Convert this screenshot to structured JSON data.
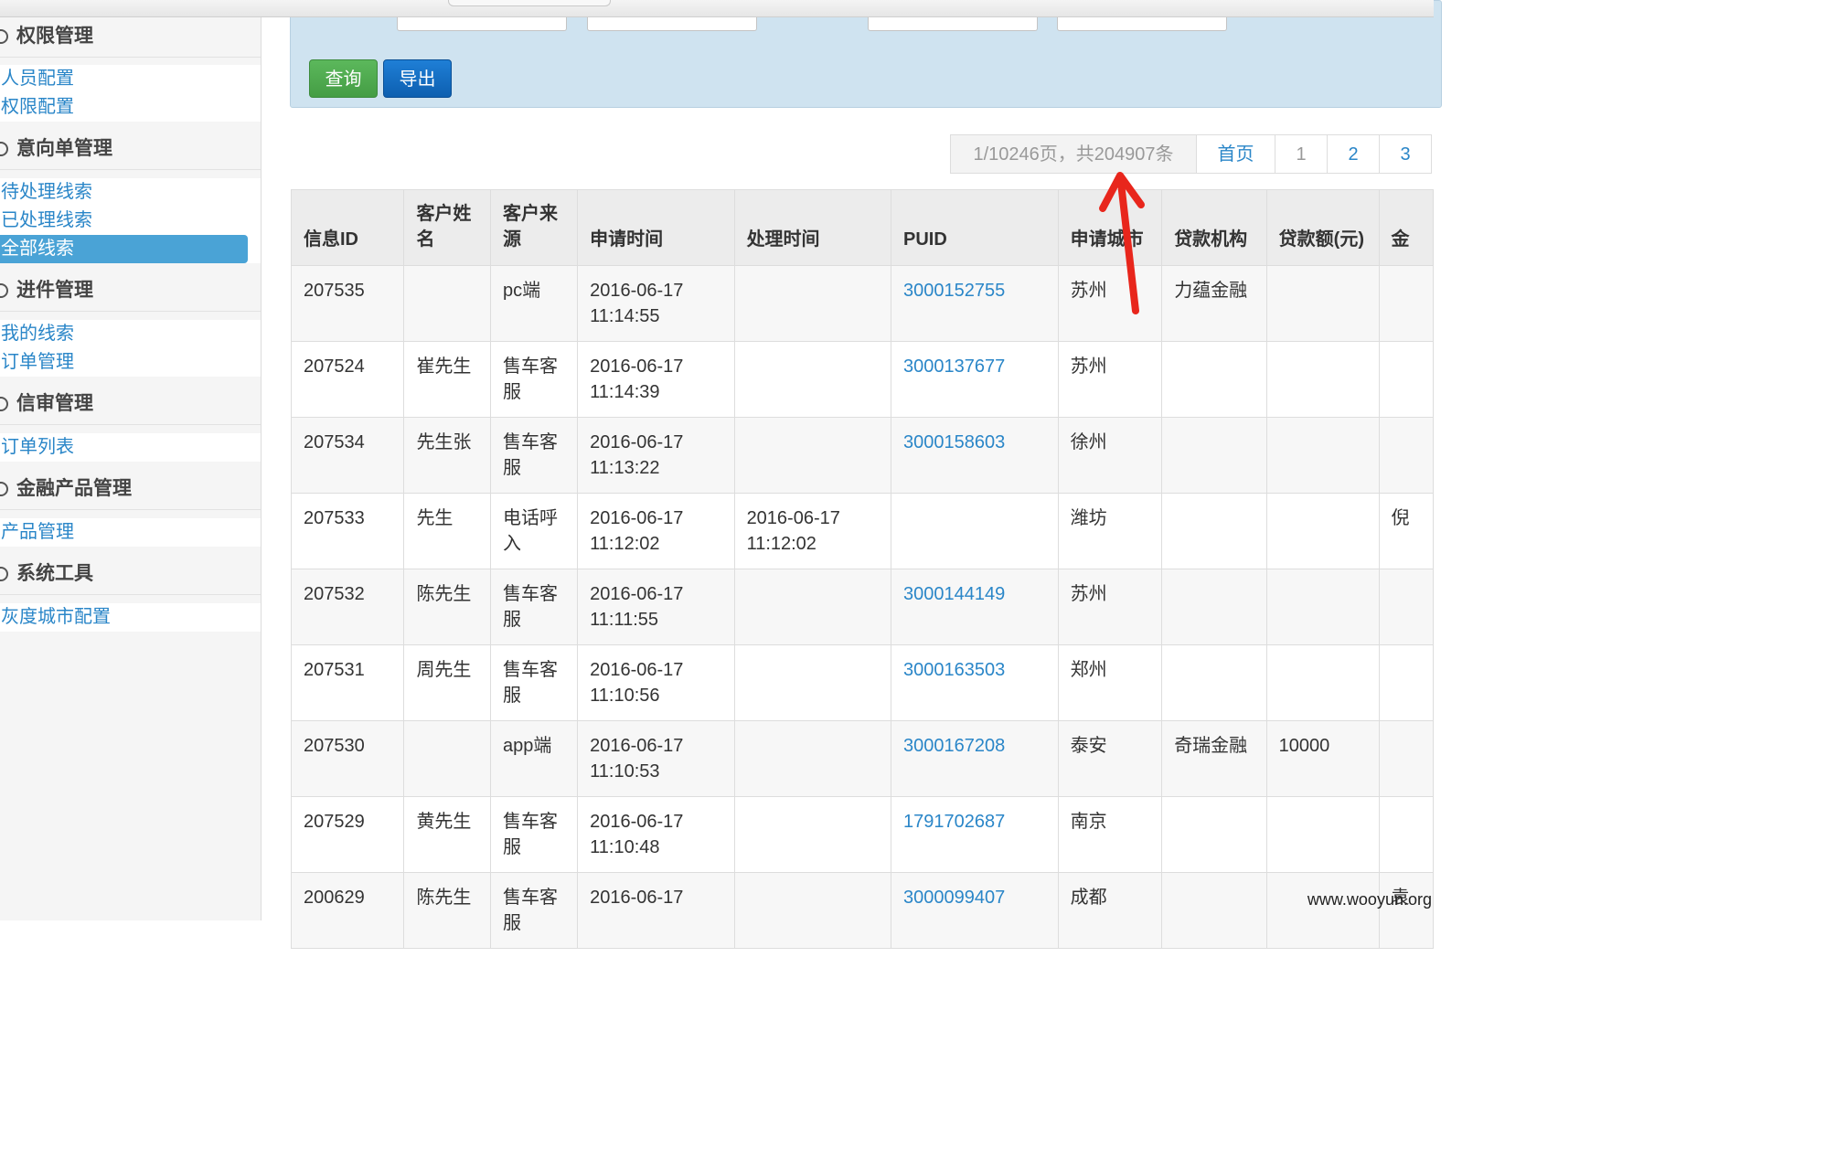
{
  "sidebar": {
    "sections": [
      {
        "title": "权限管理",
        "items": [
          {
            "label": "人员配置"
          },
          {
            "label": "权限配置"
          }
        ]
      },
      {
        "title": "意向单管理",
        "items": [
          {
            "label": "待处理线索"
          },
          {
            "label": "已处理线索"
          },
          {
            "label": "全部线索",
            "active": true
          }
        ]
      },
      {
        "title": "进件管理",
        "items": [
          {
            "label": "我的线索"
          },
          {
            "label": "订单管理"
          }
        ]
      },
      {
        "title": "信审管理",
        "items": [
          {
            "label": "订单列表"
          }
        ]
      },
      {
        "title": "金融产品管理",
        "items": [
          {
            "label": "产品管理"
          }
        ]
      },
      {
        "title": "系统工具",
        "items": [
          {
            "label": "灰度城市配置"
          }
        ]
      }
    ]
  },
  "search": {
    "query_label": "查询",
    "export_label": "导出"
  },
  "pagination": {
    "info": "1/10246页，共204907条",
    "first": "首页",
    "pages": [
      "1",
      "2",
      "3"
    ]
  },
  "table": {
    "headers": [
      "信息ID",
      "客户姓名",
      "客户来源",
      "申请时间",
      "处理时间",
      "PUID",
      "申请城市",
      "贷款机构",
      "贷款额(元)",
      "金"
    ],
    "rows": [
      [
        "207535",
        "",
        "pc端",
        "2016-06-17 11:14:55",
        "",
        "3000152755",
        "苏州",
        "力蕴金融",
        "",
        ""
      ],
      [
        "207524",
        "崔先生",
        "售车客服",
        "2016-06-17 11:14:39",
        "",
        "3000137677",
        "苏州",
        "",
        "",
        ""
      ],
      [
        "207534",
        "先生张",
        "售车客服",
        "2016-06-17 11:13:22",
        "",
        "3000158603",
        "徐州",
        "",
        "",
        ""
      ],
      [
        "207533",
        "先生",
        "电话呼入",
        "2016-06-17 11:12:02",
        "2016-06-17 11:12:02",
        "",
        "潍坊",
        "",
        "",
        "倪"
      ],
      [
        "207532",
        "陈先生",
        "售车客服",
        "2016-06-17 11:11:55",
        "",
        "3000144149",
        "苏州",
        "",
        "",
        ""
      ],
      [
        "207531",
        "周先生",
        "售车客服",
        "2016-06-17 11:10:56",
        "",
        "3000163503",
        "郑州",
        "",
        "",
        ""
      ],
      [
        "207530",
        "",
        "app端",
        "2016-06-17 11:10:53",
        "",
        "3000167208",
        "泰安",
        "奇瑞金融",
        "10000",
        ""
      ],
      [
        "207529",
        "黄先生",
        "售车客服",
        "2016-06-17 11:10:48",
        "",
        "1791702687",
        "南京",
        "",
        "",
        ""
      ],
      [
        "200629",
        "陈先生",
        "售车客服",
        "2016-06-17",
        "",
        "3000099407",
        "成都",
        "",
        "",
        "袁"
      ]
    ]
  },
  "watermark": "www.wooyun.org",
  "colors": {
    "link": "#2a86c8",
    "active_bg": "#4aa3d6",
    "query_btn": "#5cb85c",
    "export_btn": "#1266c4",
    "annotation": "#e8261c"
  }
}
